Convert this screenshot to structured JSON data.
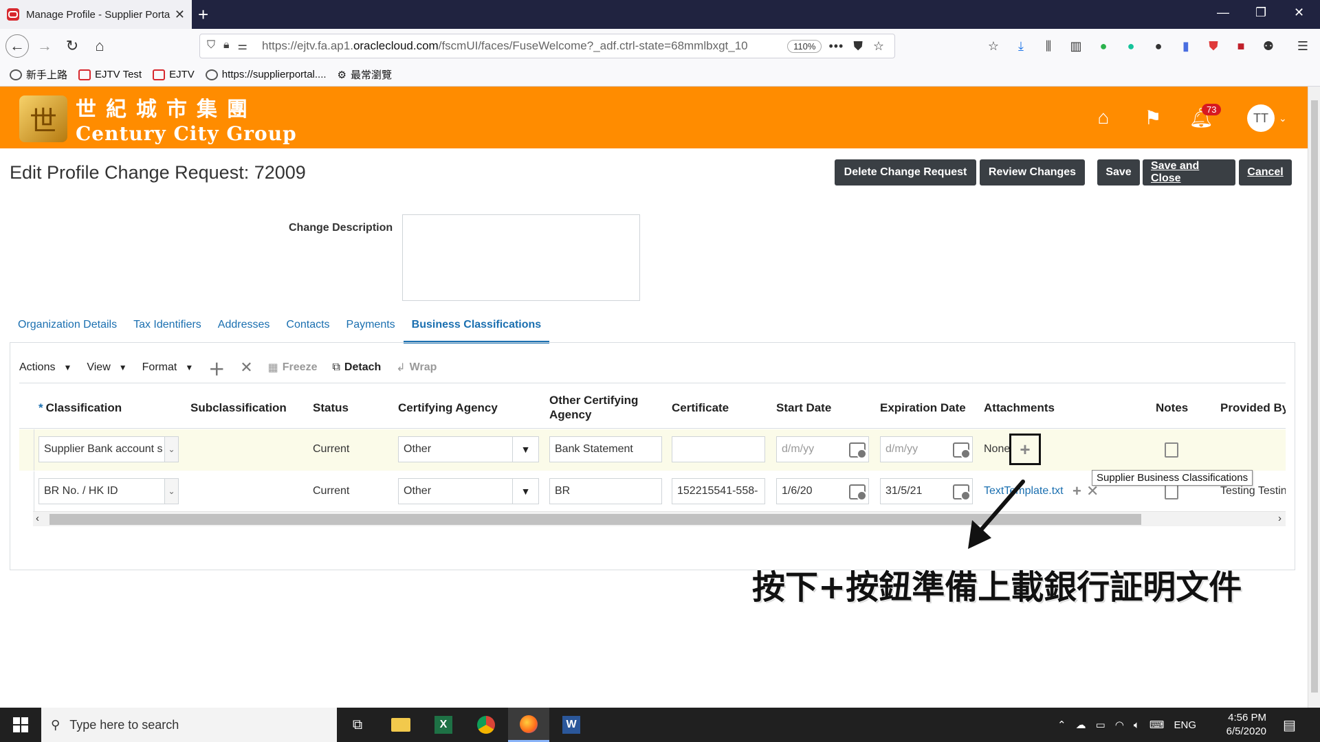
{
  "browser": {
    "tab_title": "Manage Profile - Supplier Porta",
    "url_prefix": "https://ejtv.fa.ap1.",
    "url_domain": "oraclecloud.com",
    "url_rest": "/fscmUI/faces/FuseWelcome?_adf.ctrl-state=68mmlbxgt_10",
    "zoom": "110%",
    "bookmarks": [
      "新手上路",
      "EJTV Test",
      "EJTV",
      "https://supplierportal....",
      "最常瀏覽"
    ]
  },
  "header": {
    "logo_cn": "世紀城市集團",
    "logo_en": "Century City Group",
    "notification_count": "73",
    "avatar_initials": "TT"
  },
  "page": {
    "title": "Edit Profile Change Request: 72009",
    "buttons": {
      "delete": "Delete Change Request",
      "review": "Review Changes",
      "save": "Save",
      "save_close": "Save and Close",
      "cancel": "Cancel"
    },
    "change_description_label": "Change Description"
  },
  "tabs": [
    "Organization Details",
    "Tax Identifiers",
    "Addresses",
    "Contacts",
    "Payments",
    "Business Classifications"
  ],
  "toolbar": {
    "actions": "Actions",
    "view": "View",
    "format": "Format",
    "freeze": "Freeze",
    "detach": "Detach",
    "wrap": "Wrap"
  },
  "table": {
    "columns": [
      "Classification",
      "Subclassification",
      "Status",
      "Certifying Agency",
      "Other Certifying Agency",
      "Certificate",
      "Start Date",
      "Expiration Date",
      "Attachments",
      "Notes",
      "Provided By"
    ],
    "date_placeholder": "d/m/yy",
    "rows": [
      {
        "classification": "Supplier Bank account s",
        "status": "Current",
        "certifying_agency": "Other",
        "other_agency": "Bank Statement",
        "certificate": "",
        "start_date": "",
        "expiration_date": "",
        "attachments": "None",
        "provided_by": ""
      },
      {
        "classification": "BR No. / HK ID",
        "status": "Current",
        "certifying_agency": "Other",
        "other_agency": "BR",
        "certificate": "152215541-558-",
        "start_date": "1/6/20",
        "expiration_date": "31/5/21",
        "attachments": "TextTemplate.txt",
        "provided_by": "Testing Testin"
      }
    ]
  },
  "tooltip": "Supplier Business Classifications",
  "annotation": "按下+按鈕準備上載銀行証明文件",
  "taskbar": {
    "search_placeholder": "Type here to search",
    "language": "ENG",
    "time": "4:56 PM",
    "date": "6/5/2020"
  },
  "colors": {
    "header_orange": "#ff8c00",
    "link_blue": "#1a6fb0",
    "button_dark": "#3a3f44"
  }
}
